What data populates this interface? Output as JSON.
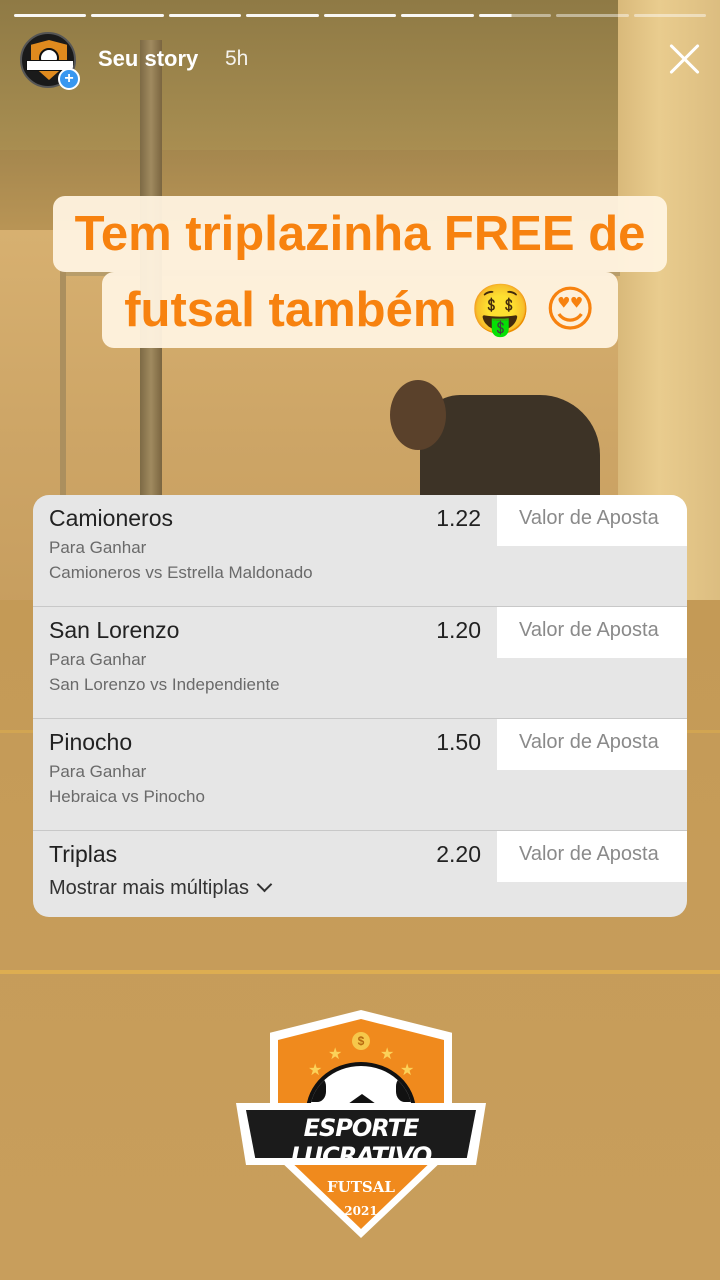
{
  "story": {
    "username": "Seu story",
    "time_ago": "5h",
    "progress_segments": 9,
    "current_segment_index": 6,
    "current_segment_progress": 0.45
  },
  "caption": {
    "line1": "Tem triplazinha FREE de",
    "line2": "futsal também 🤑 😍"
  },
  "bets": [
    {
      "selection": "Camioneros",
      "odds": "1.22",
      "market": "Para Ganhar",
      "match": "Camioneros vs Estrella Maldonado",
      "stake_placeholder": "Valor de Aposta"
    },
    {
      "selection": "San Lorenzo",
      "odds": "1.20",
      "market": "Para Ganhar",
      "match": "San Lorenzo vs Independiente",
      "stake_placeholder": "Valor de Aposta"
    },
    {
      "selection": "Pinocho",
      "odds": "1.50",
      "market": "Para Ganhar",
      "match": "Hebraica vs Pinocho",
      "stake_placeholder": "Valor de Aposta"
    }
  ],
  "multiple": {
    "label": "Triplas",
    "odds": "2.20",
    "show_more": "Mostrar mais múltiplas",
    "stake_placeholder": "Valor de Aposta"
  },
  "logo": {
    "brand": "ESPORTE LUCRATIVO",
    "sport": "FUTSAL",
    "year": "2021",
    "coin_symbol": "$"
  },
  "colors": {
    "caption_text": "#f7820f",
    "caption_bg": "#fff3e0",
    "card_bg": "#e6e6e6",
    "logo_orange": "#f08a1d"
  },
  "icons": {
    "close": "close-icon",
    "add": "plus-icon",
    "chevron": "chevron-down-icon"
  }
}
